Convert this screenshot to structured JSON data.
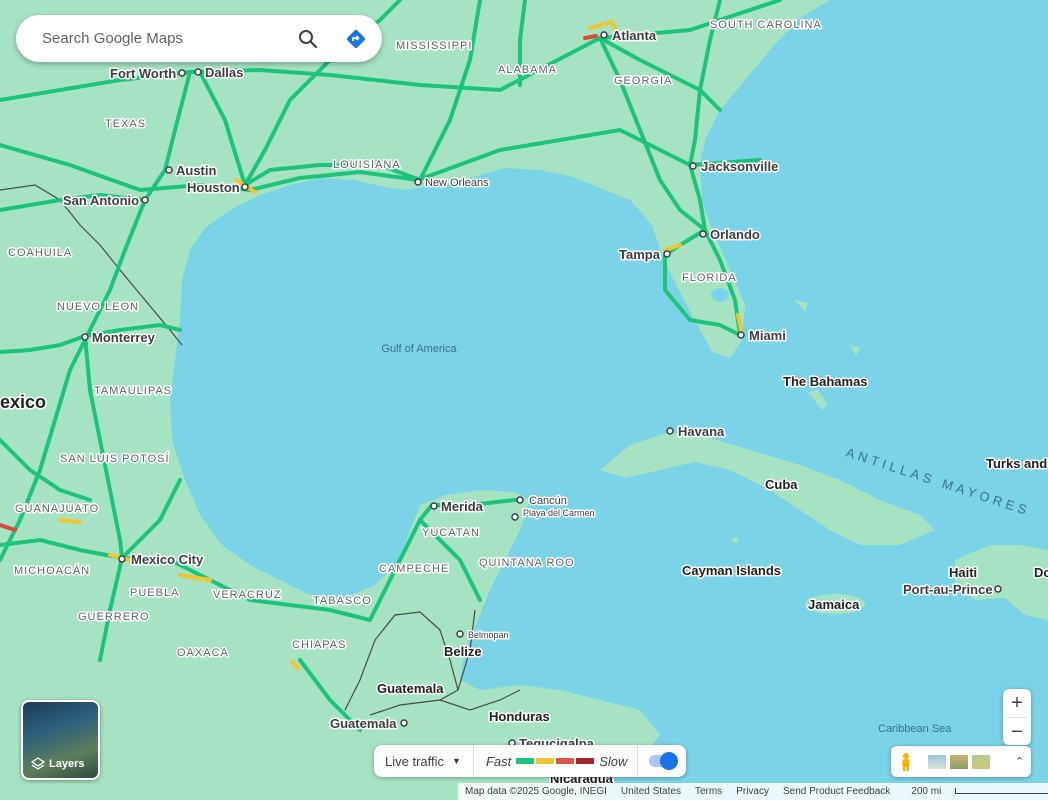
{
  "search": {
    "placeholder": "Search Google Maps"
  },
  "icons": {
    "search": "search-icon",
    "directions": "directions-icon",
    "layers": "layers-icon",
    "pegman": "pegman-icon"
  },
  "labels": {
    "cities": {
      "fort_worth": "Fort Worth",
      "dallas": "Dallas",
      "austin": "Austin",
      "houston": "Houston",
      "san_antonio": "San Antonio",
      "new_orleans": "New Orleans",
      "atlanta": "Atlanta",
      "jacksonville": "Jacksonville",
      "orlando": "Orlando",
      "tampa": "Tampa",
      "miami": "Miami",
      "monterrey": "Monterrey",
      "havana": "Havana",
      "merida": "Merida",
      "cancun": "Cancún",
      "playa": "Playa del Carmen",
      "mexico_city": "Mexico City",
      "belmopan": "Belmopan",
      "guatemala_city": "Guatemala",
      "tegucigalpa": "Tegucigalpa",
      "port_au_prince": "Port-au-Prince"
    },
    "regions": {
      "mississippi": "MISSISSIPPI",
      "alabama": "ALABAMA",
      "georgia": "GEORGIA",
      "south_carolina": "SOUTH CAROLINA",
      "texas": "TEXAS",
      "louisiana": "LOUISIANA",
      "florida": "FLORIDA",
      "coahuila": "COAHUILA",
      "nuevo_leon": "NUEVO LEON",
      "tamaulipas": "TAMAULIPAS",
      "san_luis": "SAN LUIS POTOSÍ",
      "guanajuato": "GUANAJUATO",
      "michoacan": "MICHOACÁN",
      "guerrero": "GUERRERO",
      "puebla": "PUEBLA",
      "veracruz": "VERACRUZ",
      "oaxaca": "OAXACA",
      "tabasco": "TABASCO",
      "chiapas": "CHIAPAS",
      "campeche": "CAMPECHE",
      "yucatan": "YUCATAN",
      "quintana_roo": "QUINTANA ROO"
    },
    "countries": {
      "mexico": "exico",
      "bahamas": "The Bahamas",
      "cuba": "Cuba",
      "cayman": "Cayman Islands",
      "jamaica": "Jamaica",
      "haiti": "Haiti",
      "turks": "Turks and Caicos Islands",
      "dominican": "Do Re",
      "belize": "Belize",
      "guatemala": "Guatemala",
      "honduras": "Honduras",
      "nicaragua": "Nicaragua"
    },
    "water": {
      "gulf": "Gulf of America",
      "antillas": "ANTILLAS MAYORES",
      "caribbean": "Caribbean Sea"
    }
  },
  "layers": {
    "label": "Layers"
  },
  "traffic": {
    "selector": "Live traffic",
    "fast": "Fast",
    "slow": "Slow",
    "colors": [
      "#1ec47c",
      "#f2c530",
      "#e0574a",
      "#a8262b"
    ],
    "toggle_on": true
  },
  "zoom": {
    "in": "+",
    "out": "−"
  },
  "footer": {
    "map_data": "Map data ©2025 Google, INEGI",
    "region": "United States",
    "terms": "Terms",
    "privacy": "Privacy",
    "feedback": "Send Product Feedback",
    "scale": "200 mi"
  },
  "colors": {
    "water": "#7ad3e6",
    "land": "#a6e3c2",
    "road": "#1cc47a"
  }
}
